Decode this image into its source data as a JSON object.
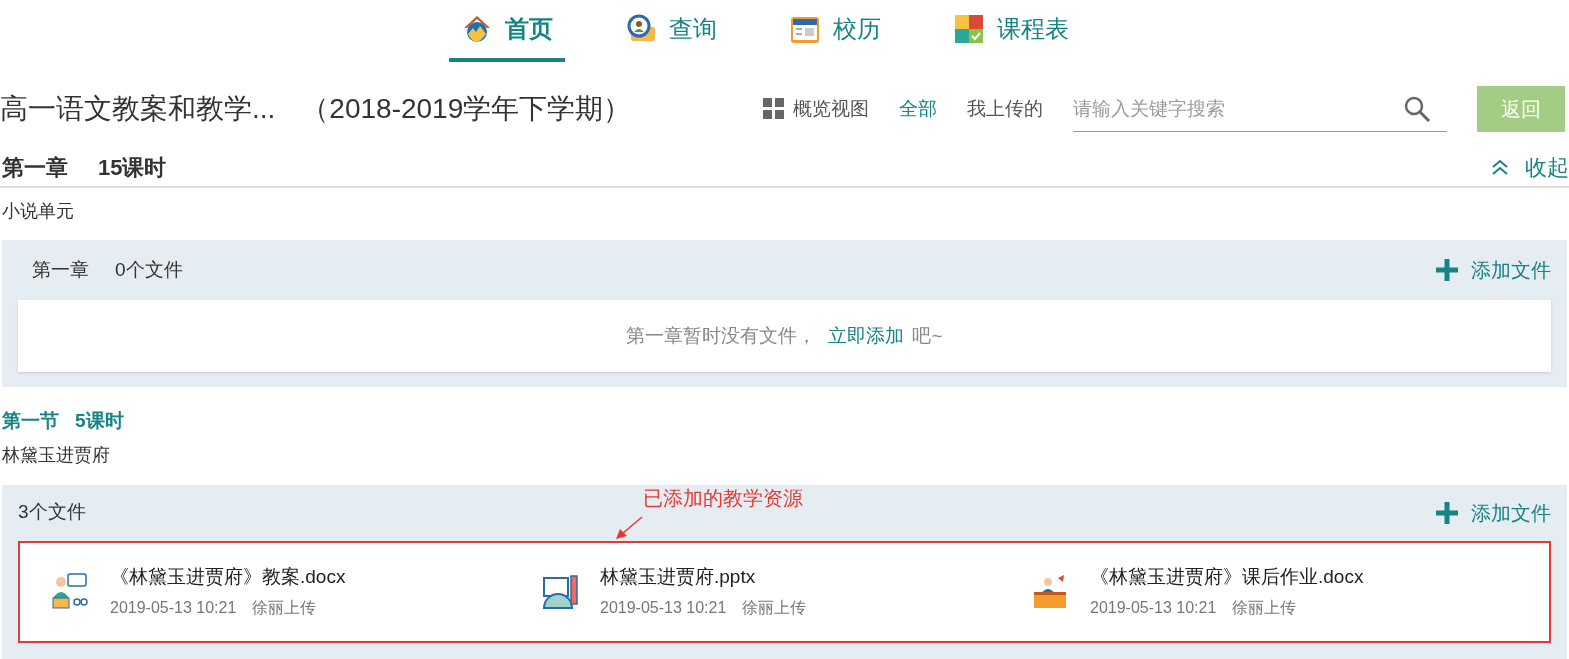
{
  "nav": [
    {
      "label": "首页",
      "selected": true
    },
    {
      "label": "查询",
      "selected": false
    },
    {
      "label": "校历",
      "selected": false
    },
    {
      "label": "课程表",
      "selected": false
    }
  ],
  "header": {
    "title": "高一语文教案和教学...",
    "term": "（2018-2019学年下学期）",
    "view_label": "概览视图",
    "filters": [
      {
        "label": "全部",
        "selected": true
      },
      {
        "label": "我上传的",
        "selected": false
      }
    ],
    "search": {
      "placeholder": "请输入关键字搜索"
    },
    "back_button": "返回"
  },
  "chapter": {
    "title": "第一章",
    "hours": "15课时",
    "collapse_label": "收起",
    "subtitle": "小说单元",
    "panel": {
      "name": "第一章",
      "count": "0个文件",
      "add_label": "添加文件",
      "empty_text": "第一章暂时没有文件，",
      "empty_link": "立即添加",
      "empty_suffix": "吧~"
    }
  },
  "section": {
    "title": "第一节",
    "hours": "5课时",
    "subtitle": "林黛玉进贾府",
    "panel": {
      "count": "3个文件",
      "add_label": "添加文件",
      "files": [
        {
          "name": "《林黛玉进贾府》教案.docx",
          "date": "2019-05-13 10:21",
          "uploader": "徐丽上传",
          "kind": "lesson"
        },
        {
          "name": "林黛玉进贾府.pptx",
          "date": "2019-05-13 10:21",
          "uploader": "徐丽上传",
          "kind": "slides"
        },
        {
          "name": "《林黛玉进贾府》课后作业.docx",
          "date": "2019-05-13 10:21",
          "uploader": "徐丽上传",
          "kind": "homework"
        }
      ]
    },
    "annotation": "已添加的教学资源"
  }
}
